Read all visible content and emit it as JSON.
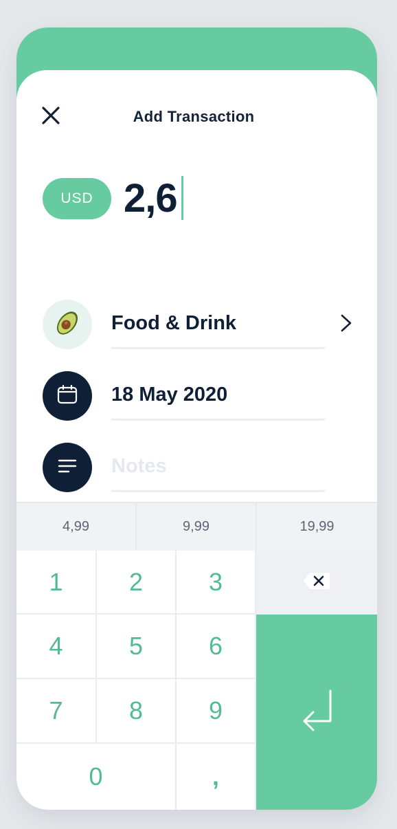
{
  "header": {
    "title": "Add Transaction",
    "close_icon": "close-icon"
  },
  "amount": {
    "currency": "USD",
    "value": "2,6"
  },
  "category": {
    "label": "Food & Drink",
    "icon": "avocado-icon"
  },
  "date": {
    "label": "18 May 2020",
    "icon": "calendar-icon"
  },
  "notes": {
    "placeholder": "Notes",
    "icon": "notes-icon"
  },
  "quick_amounts": [
    "4,99",
    "9,99",
    "19,99"
  ],
  "keypad": {
    "keys": [
      "1",
      "2",
      "3",
      "4",
      "5",
      "6",
      "7",
      "8",
      "9",
      "0",
      ","
    ],
    "backspace_icon": "backspace-icon",
    "enter_icon": "enter-icon"
  },
  "colors": {
    "accent": "#66cba0",
    "dark": "#0f1f35",
    "background": "#e6e9ec"
  }
}
